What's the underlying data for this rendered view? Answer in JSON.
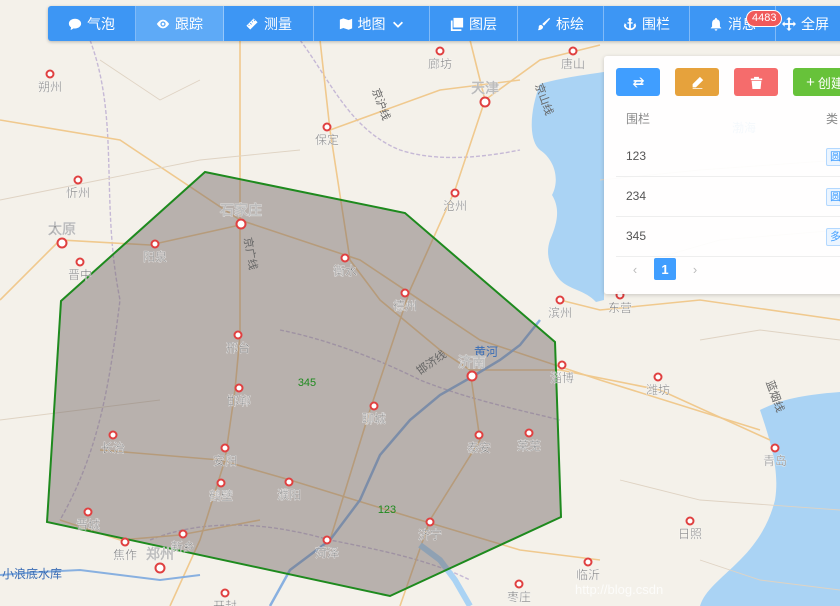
{
  "toolbar": {
    "items": [
      {
        "label": "气泡",
        "icon": "chat-bubble-icon"
      },
      {
        "label": "跟踪",
        "icon": "eye-icon"
      },
      {
        "label": "测量",
        "icon": "ruler-icon"
      },
      {
        "label": "地图",
        "icon": "map-icon"
      },
      {
        "label": "图层",
        "icon": "layers-icon"
      },
      {
        "label": "标绘",
        "icon": "brush-icon"
      },
      {
        "label": "围栏",
        "icon": "anchor-icon"
      },
      {
        "label": "消息",
        "icon": "bell-icon"
      },
      {
        "label": "全屏",
        "icon": "move-icon"
      }
    ],
    "message_count": "4483"
  },
  "panel": {
    "create_label": "创建",
    "col_fence": "围栏",
    "col_type": "类",
    "rows": [
      {
        "name": "123",
        "tag": "圆"
      },
      {
        "name": "234",
        "tag": "圆"
      },
      {
        "name": "345",
        "tag": "多"
      }
    ],
    "current_page": "1"
  },
  "map": {
    "sea_label": "渤海",
    "river_label": "黄河",
    "lake_label": "小浪底水库",
    "fence_labels": [
      "345",
      "123"
    ],
    "watermark": "http://blog.csdn",
    "roads": [
      {
        "text": "京沪线"
      },
      {
        "text": "京广线"
      },
      {
        "text": "京山线"
      },
      {
        "text": "邯济线"
      },
      {
        "text": "蓝烟线"
      }
    ],
    "cities": [
      {
        "name": "朔州",
        "major": false
      },
      {
        "name": "忻州",
        "major": false
      },
      {
        "name": "太原",
        "major": true
      },
      {
        "name": "晋中",
        "major": false
      },
      {
        "name": "阳泉",
        "major": false
      },
      {
        "name": "石家庄",
        "major": true
      },
      {
        "name": "保定",
        "major": false
      },
      {
        "name": "廊坊",
        "major": false
      },
      {
        "name": "天津",
        "major": true
      },
      {
        "name": "唐山",
        "major": false
      },
      {
        "name": "沧州",
        "major": false
      },
      {
        "name": "衡水",
        "major": false
      },
      {
        "name": "德州",
        "major": false
      },
      {
        "name": "邢台",
        "major": false
      },
      {
        "name": "邯郸",
        "major": false
      },
      {
        "name": "聊城",
        "major": false
      },
      {
        "name": "济南",
        "major": true
      },
      {
        "name": "滨州",
        "major": false
      },
      {
        "name": "东营",
        "major": false
      },
      {
        "name": "淄博",
        "major": false
      },
      {
        "name": "潍坊",
        "major": false
      },
      {
        "name": "长治",
        "major": false
      },
      {
        "name": "安阳",
        "major": false
      },
      {
        "name": "泰安",
        "major": false
      },
      {
        "name": "莱芜",
        "major": false
      },
      {
        "name": "鹤壁",
        "major": false
      },
      {
        "name": "濮阳",
        "major": false
      },
      {
        "name": "青岛",
        "major": false
      },
      {
        "name": "晋城",
        "major": false
      },
      {
        "name": "焦作",
        "major": false
      },
      {
        "name": "新乡",
        "major": false
      },
      {
        "name": "菏泽",
        "major": false
      },
      {
        "name": "济宁",
        "major": false
      },
      {
        "name": "日照",
        "major": false
      },
      {
        "name": "临沂",
        "major": false
      },
      {
        "name": "郑州",
        "major": true
      },
      {
        "name": "开封",
        "major": false
      },
      {
        "name": "枣庄",
        "major": false
      }
    ]
  }
}
